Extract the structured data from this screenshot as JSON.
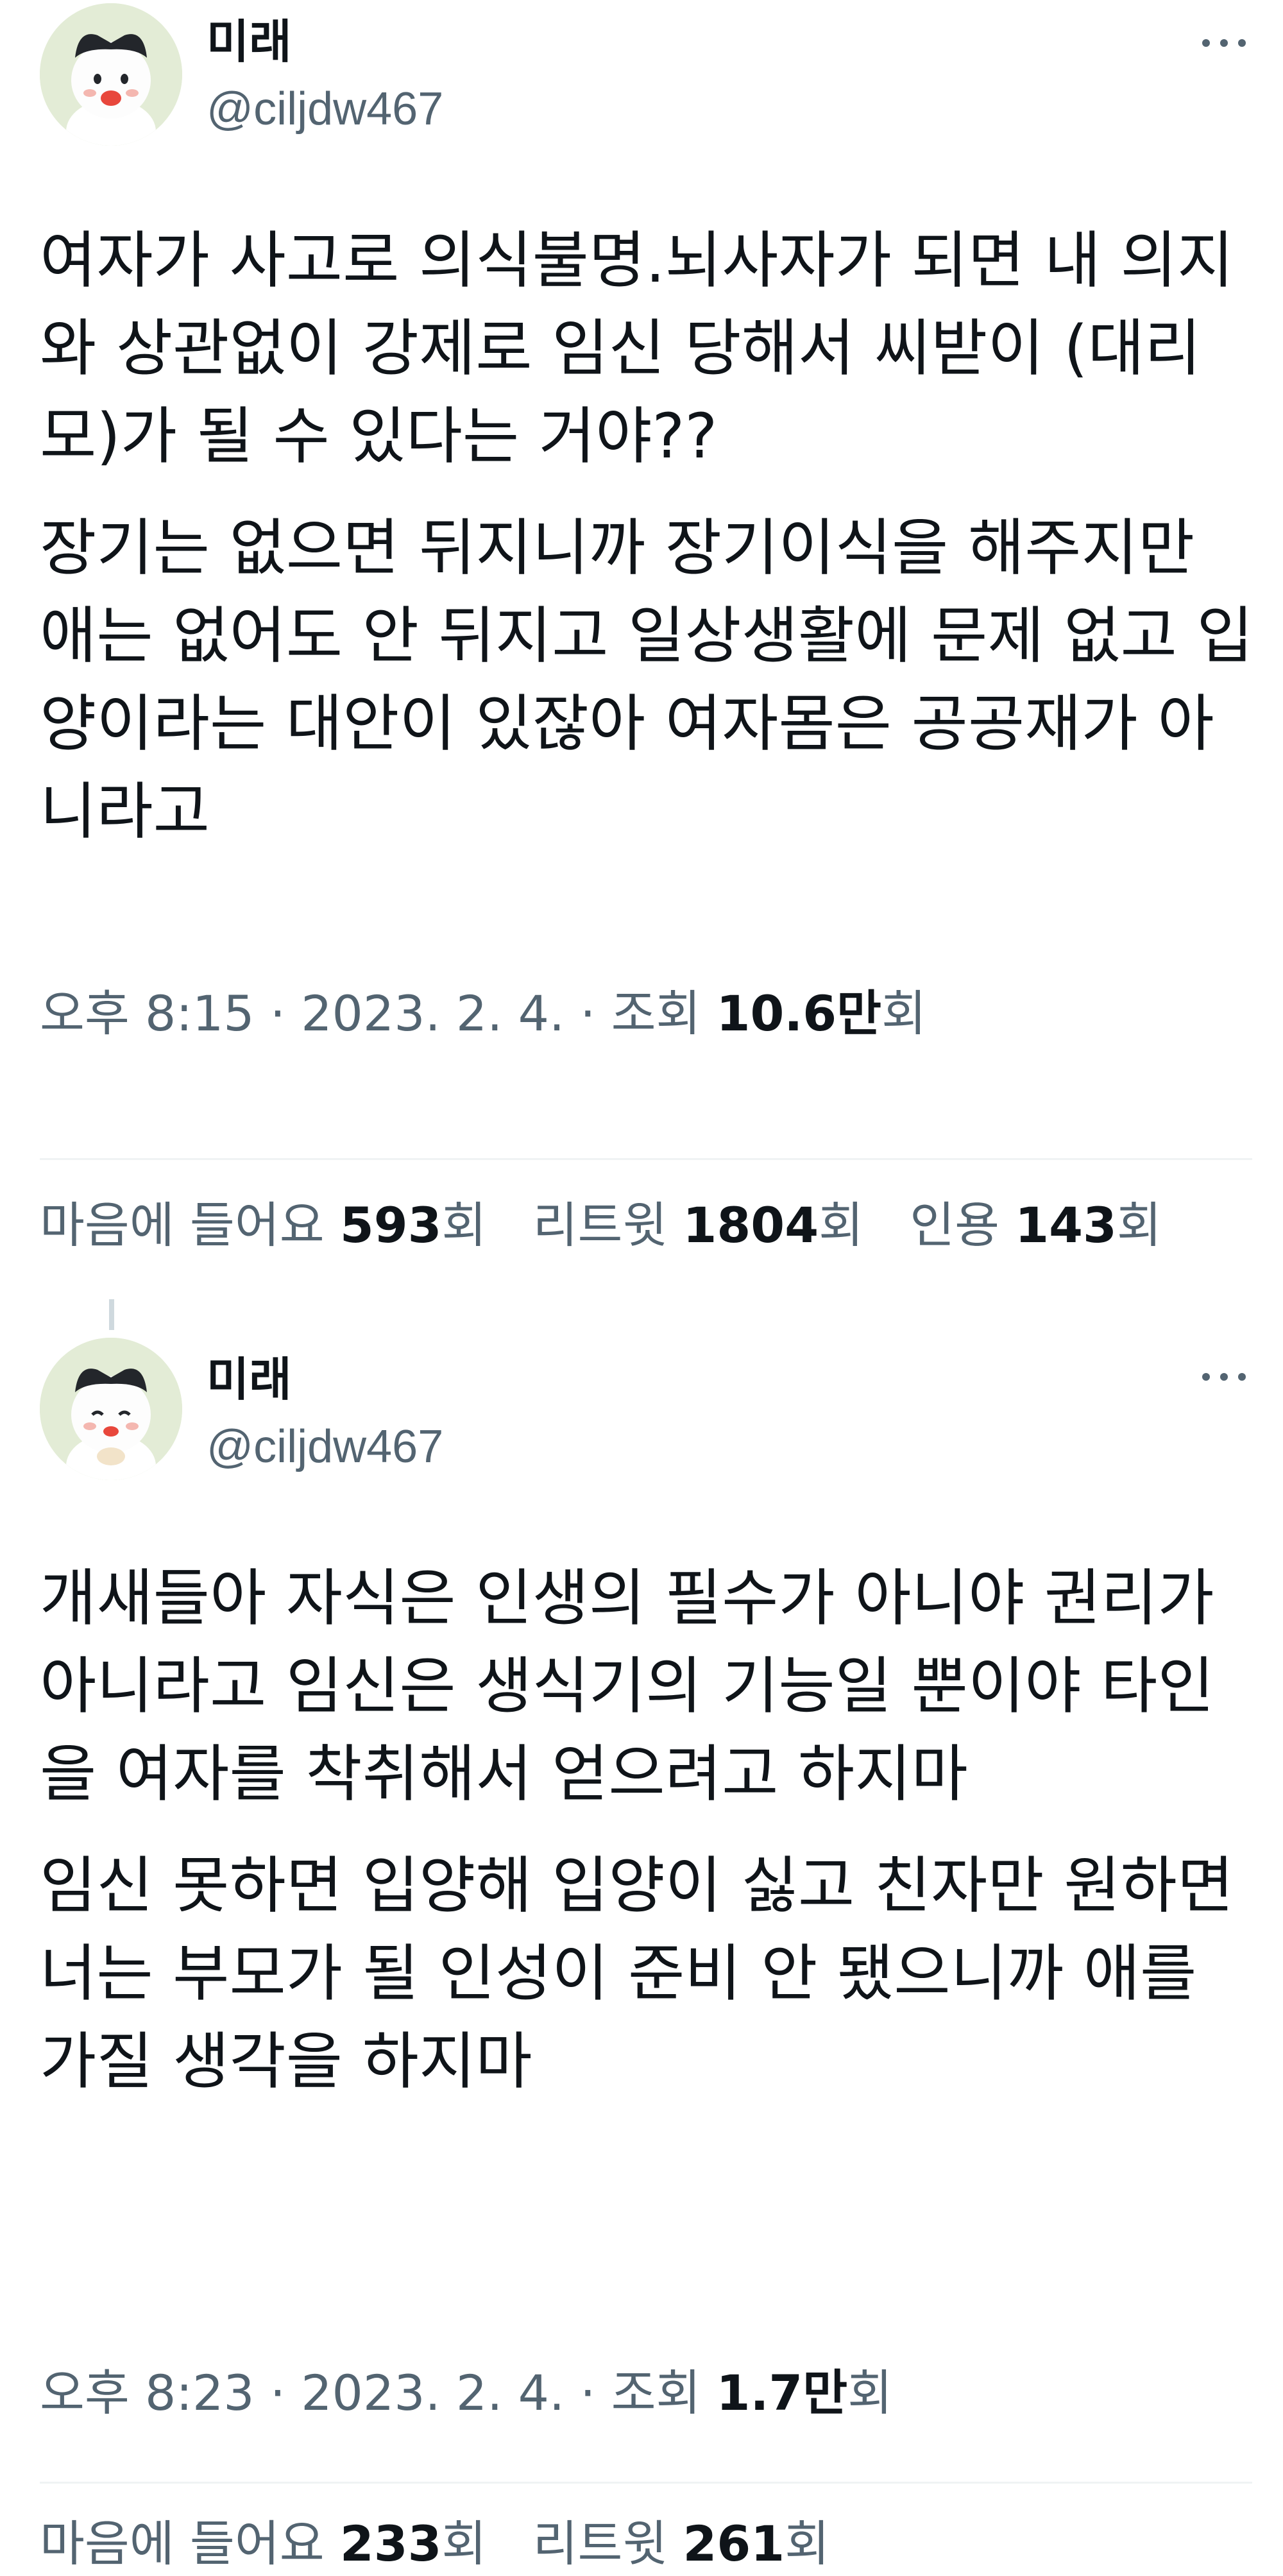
{
  "tweets": [
    {
      "author": {
        "display_name": "미래",
        "handle": "@ciljdw467"
      },
      "paragraphs": [
        "여자가 사고로 의식불명.뇌사자가 되면 내 의지와 상관없이 강제로 임신 당해서 씨받이 (대리모)가 될 수 있다는 거야??",
        "장기는 없으면 뒤지니까 장기이식을 해주지만 애는 없어도 안 뒤지고 일상생활에 문제 없고 입양이라는 대안이 있잖아 여자몸은 공공재가 아니라고"
      ],
      "meta": {
        "time": "오후 8:15",
        "sep1": "·",
        "date": "2023. 2. 4.",
        "sep2": "·",
        "views_label": "조회",
        "views_value": "10.6만",
        "views_unit": "회"
      },
      "stats": [
        {
          "label": "마음에 들어요",
          "value": "593",
          "unit": "회"
        },
        {
          "label": "리트윗",
          "value": "1804",
          "unit": "회"
        },
        {
          "label": "인용",
          "value": "143",
          "unit": "회"
        }
      ],
      "icons": {
        "more": "more-options-icon"
      }
    },
    {
      "author": {
        "display_name": "미래",
        "handle": "@ciljdw467"
      },
      "paragraphs": [
        "개새들아 자식은 인생의 필수가 아니야 권리가 아니라고 임신은 생식기의 기능일 뿐이야 타인을 여자를 착취해서 얻으려고 하지마",
        "임신 못하면 입양해 입양이 싫고 친자만 원하면 너는 부모가 될 인성이 준비 안 됐으니까 애를 가질 생각을 하지마"
      ],
      "meta": {
        "time": "오후 8:23",
        "sep1": "·",
        "date": "2023. 2. 4.",
        "sep2": "·",
        "views_label": "조회",
        "views_value": "1.7만",
        "views_unit": "회"
      },
      "stats": [
        {
          "label": "마음에 들어요",
          "value": "233",
          "unit": "회"
        },
        {
          "label": "리트윗",
          "value": "261",
          "unit": "회"
        }
      ],
      "icons": {
        "more": "more-options-icon"
      }
    }
  ],
  "colors": {
    "text": "#0f1419",
    "secondary": "#536471",
    "divider": "#eff3f4",
    "avatar_bg": "#e3ecd6"
  }
}
